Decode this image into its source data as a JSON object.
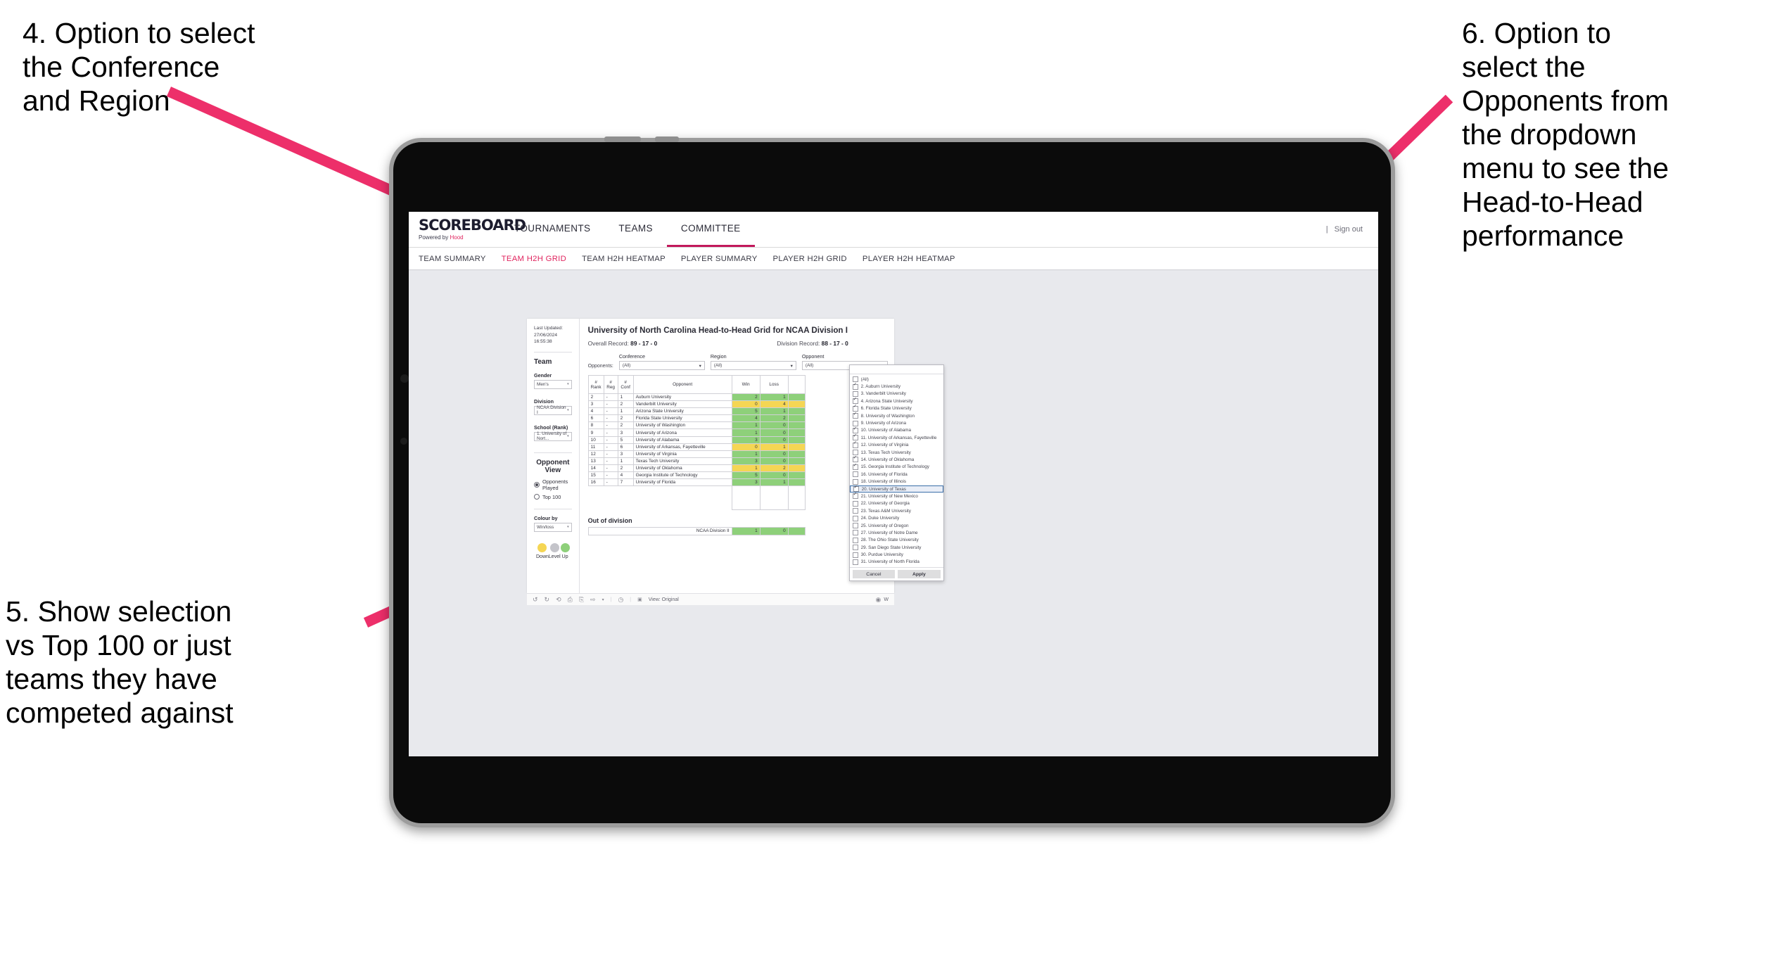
{
  "annotations": {
    "left_top": "4. Option to select\nthe Conference\nand Region",
    "left_bottom": "5. Show selection\nvs Top 100 or just\nteams they have\ncompeted against",
    "right": "6. Option to\nselect the\nOpponents from\nthe dropdown\nmenu to see the\nHead-to-Head\nperformance",
    "arrow_color": "#ed2f6a"
  },
  "site": {
    "logo": {
      "main": "SCOREBOARD",
      "sub_prefix": "Powered by ",
      "sub_brand": "Hood"
    },
    "topnav": [
      {
        "label": "TOURNAMENTS",
        "active": false
      },
      {
        "label": "TEAMS",
        "active": false
      },
      {
        "label": "COMMITTEE",
        "active": true
      }
    ],
    "sign_out": "Sign out",
    "subnav": [
      {
        "label": "TEAM SUMMARY",
        "active": false
      },
      {
        "label": "TEAM H2H GRID",
        "active": true
      },
      {
        "label": "TEAM H2H HEATMAP",
        "active": false
      },
      {
        "label": "PLAYER SUMMARY",
        "active": false
      },
      {
        "label": "PLAYER H2H GRID",
        "active": false
      },
      {
        "label": "PLAYER H2H HEATMAP",
        "active": false
      }
    ]
  },
  "sidebar": {
    "last_updated": "Last Updated: 27/06/2024\n16:55:38",
    "team_heading": "Team",
    "gender": {
      "label": "Gender",
      "value": "Men's"
    },
    "division": {
      "label": "Division",
      "value": "NCAA Division I"
    },
    "school": {
      "label": "School (Rank)",
      "value": "1. University of Nort..."
    },
    "opponent_view": {
      "heading": "Opponent View",
      "options": [
        {
          "label": "Opponents Played",
          "selected": true
        },
        {
          "label": "Top 100",
          "selected": false
        }
      ]
    },
    "colour_by": {
      "label": "Colour by",
      "value": "Win/loss"
    },
    "legend": [
      {
        "label": "Down",
        "color": "#f5d654"
      },
      {
        "label": "Level",
        "color": "#c4c4ca"
      },
      {
        "label": "Up",
        "color": "#8ed07a"
      }
    ]
  },
  "dashboard": {
    "title": "University of North Carolina Head-to-Head Grid for NCAA Division I",
    "overall_record_label": "Overall Record:",
    "overall_record_value": "89 - 17 - 0",
    "division_record_label": "Division Record:",
    "division_record_value": "88 - 17 - 0",
    "opponents_lead": "Opponents:",
    "filters": [
      {
        "label": "Conference",
        "value": "(All)"
      },
      {
        "label": "Region",
        "value": "(All)"
      },
      {
        "label": "Opponent",
        "value": "(All)"
      }
    ],
    "out_of_division_heading": "Out of division",
    "out_of_division_row": {
      "name": "NCAA Division II",
      "win": "1",
      "loss": "0"
    }
  },
  "chart_data": {
    "type": "table",
    "title": "University of North Carolina Head-to-Head Grid for NCAA Division I",
    "columns": [
      "# Rank",
      "# Reg",
      "# Conf",
      "Opponent",
      "Win",
      "Loss"
    ],
    "rows": [
      {
        "rank": "2",
        "reg": "-",
        "conf": "1",
        "opponent": "Auburn University",
        "win": "2",
        "loss": "1",
        "color": "green"
      },
      {
        "rank": "3",
        "reg": "-",
        "conf": "2",
        "opponent": "Vanderbilt University",
        "win": "0",
        "loss": "4",
        "color": "yellow"
      },
      {
        "rank": "4",
        "reg": "-",
        "conf": "1",
        "opponent": "Arizona State University",
        "win": "5",
        "loss": "1",
        "color": "green"
      },
      {
        "rank": "6",
        "reg": "-",
        "conf": "2",
        "opponent": "Florida State University",
        "win": "4",
        "loss": "2",
        "color": "green"
      },
      {
        "rank": "8",
        "reg": "-",
        "conf": "2",
        "opponent": "University of Washington",
        "win": "1",
        "loss": "0",
        "color": "green"
      },
      {
        "rank": "9",
        "reg": "-",
        "conf": "3",
        "opponent": "University of Arizona",
        "win": "1",
        "loss": "0",
        "color": "green"
      },
      {
        "rank": "10",
        "reg": "-",
        "conf": "5",
        "opponent": "University of Alabama",
        "win": "3",
        "loss": "0",
        "color": "green"
      },
      {
        "rank": "11",
        "reg": "-",
        "conf": "6",
        "opponent": "University of Arkansas, Fayetteville",
        "win": "0",
        "loss": "1",
        "color": "yellow"
      },
      {
        "rank": "12",
        "reg": "-",
        "conf": "3",
        "opponent": "University of Virginia",
        "win": "1",
        "loss": "0",
        "color": "green"
      },
      {
        "rank": "13",
        "reg": "-",
        "conf": "1",
        "opponent": "Texas Tech University",
        "win": "3",
        "loss": "0",
        "color": "green"
      },
      {
        "rank": "14",
        "reg": "-",
        "conf": "2",
        "opponent": "University of Oklahoma",
        "win": "1",
        "loss": "2",
        "color": "yellow"
      },
      {
        "rank": "15",
        "reg": "-",
        "conf": "4",
        "opponent": "Georgia Institute of Technology",
        "win": "5",
        "loss": "0",
        "color": "green"
      },
      {
        "rank": "16",
        "reg": "-",
        "conf": "7",
        "opponent": "University of Florida",
        "win": "3",
        "loss": "1",
        "color": "green"
      }
    ],
    "out_of_division": [
      {
        "opponent": "NCAA Division II",
        "win": "1",
        "loss": "0",
        "color": "green"
      }
    ],
    "legend_colors": {
      "down": "#f5d654",
      "level": "#c4c4ca",
      "up": "#8ed07a"
    }
  },
  "opponent_dropdown": {
    "items": [
      {
        "label": "(All)",
        "checked": false,
        "highlighted": false
      },
      {
        "label": "2. Auburn University",
        "checked": true,
        "highlighted": false
      },
      {
        "label": "3. Vanderbilt University",
        "checked": false,
        "highlighted": false
      },
      {
        "label": "4. Arizona State University",
        "checked": true,
        "highlighted": false
      },
      {
        "label": "6. Florida State University",
        "checked": true,
        "highlighted": false
      },
      {
        "label": "8. University of Washington",
        "checked": true,
        "highlighted": false
      },
      {
        "label": "9. University of Arizona",
        "checked": false,
        "highlighted": false
      },
      {
        "label": "10. University of Alabama",
        "checked": true,
        "highlighted": false
      },
      {
        "label": "11. University of Arkansas, Fayetteville",
        "checked": true,
        "highlighted": false
      },
      {
        "label": "12. University of Virginia",
        "checked": true,
        "highlighted": false
      },
      {
        "label": "13. Texas Tech University",
        "checked": false,
        "highlighted": false
      },
      {
        "label": "14. University of Oklahoma",
        "checked": true,
        "highlighted": false
      },
      {
        "label": "15. Georgia Institute of Technology",
        "checked": true,
        "highlighted": false
      },
      {
        "label": "16. University of Florida",
        "checked": false,
        "highlighted": false
      },
      {
        "label": "18. University of Illinois",
        "checked": false,
        "highlighted": false
      },
      {
        "label": "20. University of Texas",
        "checked": true,
        "highlighted": true
      },
      {
        "label": "21. University of New Mexico",
        "checked": true,
        "highlighted": false
      },
      {
        "label": "22. University of Georgia",
        "checked": false,
        "highlighted": false
      },
      {
        "label": "23. Texas A&M University",
        "checked": false,
        "highlighted": false
      },
      {
        "label": "24. Duke University",
        "checked": false,
        "highlighted": false
      },
      {
        "label": "25. University of Oregon",
        "checked": false,
        "highlighted": false
      },
      {
        "label": "27. University of Notre Dame",
        "checked": false,
        "highlighted": false
      },
      {
        "label": "28. The Ohio State University",
        "checked": false,
        "highlighted": false
      },
      {
        "label": "29. San Diego State University",
        "checked": false,
        "highlighted": false
      },
      {
        "label": "30. Purdue University",
        "checked": false,
        "highlighted": false
      },
      {
        "label": "31. University of North Florida",
        "checked": false,
        "highlighted": false
      }
    ],
    "cancel": "Cancel",
    "apply": "Apply"
  },
  "toolbar": {
    "icons": [
      "undo-icon",
      "redo-icon",
      "revert-icon",
      "refresh-data-icon",
      "pause-icon",
      "share-icon",
      "caret-icon"
    ],
    "clock_icon": "clock-icon",
    "view_label": "View: Original",
    "watch_label": "W"
  }
}
